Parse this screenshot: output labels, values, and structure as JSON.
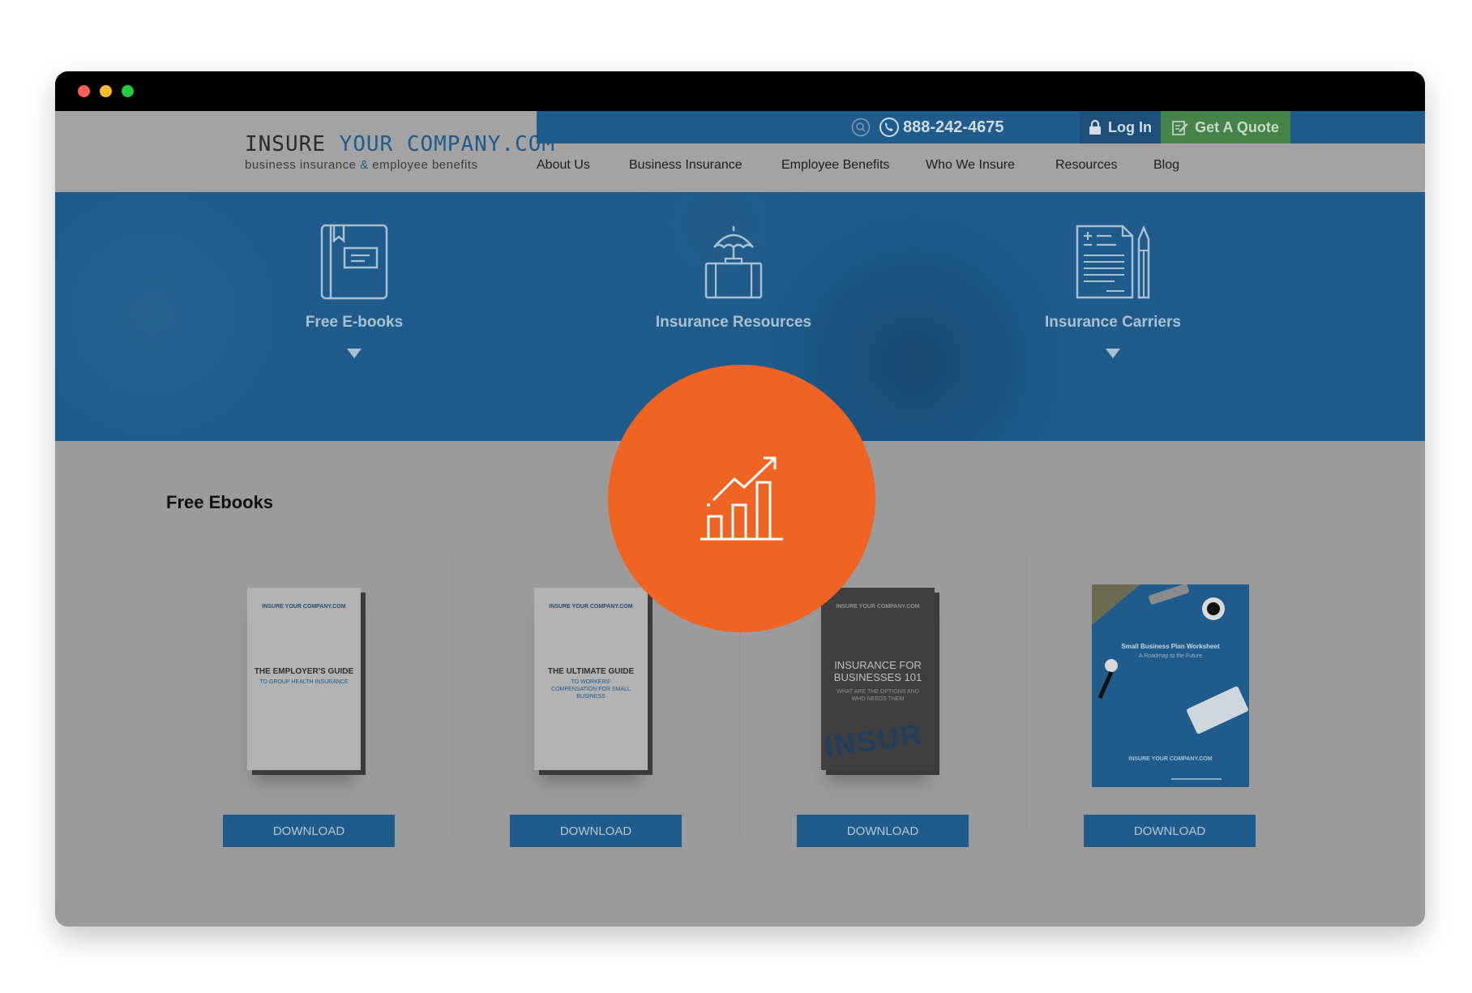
{
  "window": {
    "controls": [
      "close",
      "minimize",
      "maximize"
    ]
  },
  "header": {
    "logo": {
      "part1": "INSURE ",
      "part2": "YOUR COMPANY.COM",
      "tagline_pre": "business insurance ",
      "tagline_amp": "&",
      "tagline_post": " employee benefits"
    },
    "phone": "888-242-4675",
    "login": "Log In",
    "quote": "Get A Quote",
    "nav": [
      "About Us",
      "Business Insurance",
      "Employee Benefits",
      "Who We Insure",
      "Resources",
      "Blog"
    ]
  },
  "hero": {
    "items": [
      {
        "label": "Free E-books",
        "icon": "ebook-icon",
        "has_arrow": true
      },
      {
        "label": "Insurance Resources",
        "icon": "umbrella-briefcase-icon",
        "has_arrow": false
      },
      {
        "label": "Insurance Carriers",
        "icon": "document-pen-icon",
        "has_arrow": true
      }
    ]
  },
  "section": {
    "title": "Free Ebooks"
  },
  "ebooks": [
    {
      "brand": "INSURE YOUR COMPANY.COM",
      "title": "THE EMPLOYER'S GUIDE",
      "subtitle": "TO GROUP HEALTH INSURANCE",
      "button": "DOWNLOAD"
    },
    {
      "brand": "INSURE YOUR COMPANY.COM",
      "title": "THE ULTIMATE GUIDE",
      "subtitle": "TO WORKERS' COMPENSATION FOR SMALL BUSINESS",
      "button": "DOWNLOAD"
    },
    {
      "brand": "INSURE YOUR COMPANY.COM",
      "title": "INSURANCE FOR BUSINESSES 101",
      "subtitle": "WHAT ARE THE OPTIONS AND WHO NEEDS THEM",
      "cover_word": "INSUR",
      "button": "DOWNLOAD"
    },
    {
      "brand": "INSURE YOUR COMPANY.COM",
      "title": "Small Business Plan Worksheet",
      "subtitle": "A Roadmap to the Future",
      "button": "DOWNLOAD"
    }
  ],
  "overlay": {
    "icon": "growth-chart-icon",
    "color": "#ef6422"
  },
  "colors": {
    "brand_blue": "#1f5c8c",
    "quote_green": "#46834a",
    "overlay_orange": "#ef6422"
  }
}
